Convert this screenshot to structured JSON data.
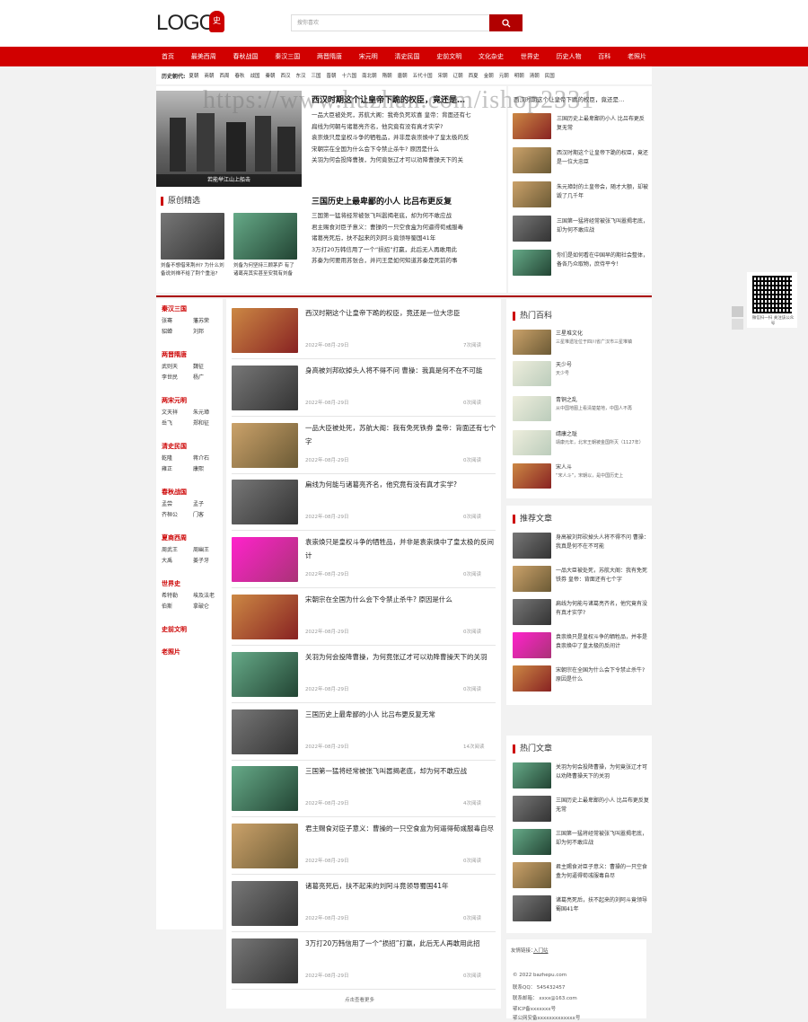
{
  "header": {
    "logo_text": "LOGO",
    "search_placeholder": "搜你喜欢"
  },
  "nav": [
    "首页",
    "最美西周",
    "春秋战国",
    "秦汉三国",
    "两晋隋唐",
    "宋元明",
    "清史民国",
    "史前文明",
    "文化杂史",
    "世界史",
    "历史人物",
    "百科",
    "老照片"
  ],
  "dynasty": {
    "label": "历史朝代:",
    "items": [
      "夏朝",
      "商朝",
      "西周",
      "春秋",
      "战国",
      "秦朝",
      "西汉",
      "东汉",
      "三国",
      "晋朝",
      "十六国",
      "南北朝",
      "隋朝",
      "唐朝",
      "五代十国",
      "宋朝",
      "辽朝",
      "西夏",
      "金朝",
      "元朝",
      "明朝",
      "清朝",
      "民国"
    ]
  },
  "watermark": "https://www.huzhan.com/ishop2331",
  "hero": {
    "caption": "若能举江山上船击"
  },
  "original": {
    "title": "原创精选",
    "items": [
      {
        "text": "刘备不想借来荆州? 为什么刘备说刘禅不给了荆个重治?"
      },
      {
        "text": "刘备为何坚持三顾茅庐 有了诸葛亮其实甚至安我有刘备"
      }
    ]
  },
  "featured": [
    {
      "title": "西汉时期这个让皇帝下跪的权臣，竟还是…",
      "lines": [
        "一品大臣被处死，苏航大阁：我奇负死欢喜 皇帝：背面还有七",
        "扁线为何朝与诸葛亮齐名，他究竟有没有真才实学?",
        "袁崇焕只是皇权斗争的牺牲品，并非是袁崇焕中了皇太极的反",
        "宋朝宗在全国为什么会下令禁止杀牛? 原因是什么",
        "关羽为何会投降曹操，为何竟张辽才可以劝降曹操天下的关"
      ]
    },
    {
      "title": "三国历史上最卑鄙的小人 比吕布更反复",
      "lines": [
        "三国第一猛将经常被张飞叫嚣揭老底，却为何不敢应战",
        "君主赐食对臣子意义：曹操的一只空食盒为何逼得荀彧服毒",
        "诸葛亮死后，扶不起来的刘阿斗竟领导蜀国41年",
        "3万打20万韩信用了一个“损招”打赢，此后无人再敢用此",
        "苏秦为何要用苏张合，并问王是如何知道苏秦是死前的事"
      ]
    }
  ],
  "right_top": [
    {
      "text": "西汉时期这个让皇帝下跪的权臣，竟还是…"
    },
    {
      "text": "三国历史上最卑鄙的小人 比吕布更反复无常"
    },
    {
      "text": "西汉时期这个让皇帝下跪的权臣，竟还是一位大忠臣"
    },
    {
      "text": "朱元璋封的土皇帝会，随才大额，却被毁了几千年"
    },
    {
      "text": "三国第一猛将经常被张飞叫嚣揭老底，却为何不敢应战"
    },
    {
      "text": "你们是如何看在中国早的期社会整体，备各乃众取物，庶侍平今！"
    }
  ],
  "sidebar": [
    {
      "cat": "秦汉三国",
      "subs": [
        "张骞",
        "藩苏荣",
        "貂蝉",
        "刘邦"
      ]
    },
    {
      "cat": "两晋隋唐",
      "subs": [
        "武则天",
        "魏征",
        "李世民",
        "杨广"
      ]
    },
    {
      "cat": "两宋元明",
      "subs": [
        "文天祥",
        "朱元璋",
        "岳飞",
        "郑和征"
      ]
    },
    {
      "cat": "清史民国",
      "subs": [
        "乾隆",
        "蒋介石",
        "雍正",
        "康熙"
      ]
    },
    {
      "cat": "春秋战国",
      "subs": [
        "孟尝",
        "孟子",
        "齐桓公",
        "门客"
      ]
    },
    {
      "cat": "夏商西周",
      "subs": [
        "周武王",
        "周幽王",
        "大禹",
        "姜子牙"
      ]
    },
    {
      "cat": "世界史",
      "subs": [
        "希特勒",
        "埃及法老",
        "伯斯",
        "拿破仑"
      ]
    },
    {
      "cat": "史前文明",
      "subs": []
    },
    {
      "cat": "老照片",
      "subs": []
    }
  ],
  "list": [
    {
      "title": "西汉时期这个让皇帝下跪的权臣，竟还是一位大忠臣",
      "date": "2022年-08月-29日",
      "views": "7次阅读"
    },
    {
      "title": "身高被刘邦砍掉头人将不得不问 曹操：我真是何不在不可能",
      "date": "2022年-08月-29日",
      "views": "0次阅读"
    },
    {
      "title": "一品大臣被处死，苏航大阁：我有免死铁券 皇帝：背面还有七个字",
      "date": "2022年-08月-29日",
      "views": "0次阅读"
    },
    {
      "title": "扁线为何能与诸葛亮齐名，他究竟有没有真才实学?",
      "date": "2022年-08月-29日",
      "views": "0次阅读"
    },
    {
      "title": "袁崇焕只是皇权斗争的牺牲品，并非是袁崇焕中了皇太极的反间计",
      "date": "2022年-08月-29日",
      "views": "0次阅读"
    },
    {
      "title": "宋朝宗在全国为什么会下令禁止杀牛? 原因是什么",
      "date": "2022年-08月-29日",
      "views": "0次阅读"
    },
    {
      "title": "关羽为何会投降曹操，为何竟张辽才可以劝降曹操天下的关羽",
      "date": "2022年-08月-29日",
      "views": "0次阅读"
    },
    {
      "title": "三国历史上最卑鄙的小人 比吕布更反复无常",
      "date": "2022年-08月-29日",
      "views": "14次阅读"
    },
    {
      "title": "三国第一猛将经常被张飞叫嚣揭老底，却为何不敢应战",
      "date": "2022年-08月-29日",
      "views": "4次阅读"
    },
    {
      "title": "君主赐食对臣子意义：曹操的一只空食盒为何逼得荀彧服毒自尽",
      "date": "2022年-08月-29日",
      "views": "0次阅读"
    },
    {
      "title": "诸葛亮死后，扶不起来的刘阿斗竟领导蜀国41年",
      "date": "2022年-08月-29日",
      "views": "0次阅读"
    },
    {
      "title": "3万打20万韩信用了一个“损招”打赢，此后无人再敢用此招",
      "date": "2022年-08月-29日",
      "views": "0次阅读"
    }
  ],
  "more": "点击查看更多",
  "hot_baike": {
    "title": "热门百科",
    "items": [
      {
        "name": "三星堆文化",
        "desc": "三星堆遗址位于四川省广汉市三星堆镇"
      },
      {
        "name": "天少号",
        "desc": "天少号"
      },
      {
        "name": "青铜之乱",
        "desc": "从中国地图上看清楚楚地，中国人不再"
      },
      {
        "name": "靖康之耻",
        "desc": "靖康元年，北宋王朝被金国所灭（1127年）"
      },
      {
        "name": "宋人斗",
        "desc": "“宋人斗”，宋朝以，是中国历史上"
      }
    ]
  },
  "recommend": {
    "title": "推荐文章",
    "items": [
      {
        "text": "身高被刘邦砍掉头人将不得不问 曹操：我真是何不在不可能"
      },
      {
        "text": "一品大臣被处死，苏航大阁：我有免死铁券 皇帝：背面还有七个字"
      },
      {
        "text": "扁线为何能与诸葛亮齐名，他究竟有没有真才实学?"
      },
      {
        "text": "袁崇焕只是皇权斗争的牺牲品，并非是袁崇焕中了皇太极的反间计"
      },
      {
        "text": "宋朝宗在全国为什么会下令禁止杀牛? 原因是什么"
      }
    ]
  },
  "hot_articles": {
    "title": "热门文章",
    "items": [
      {
        "text": "关羽为何会投降曹操，为何竟张辽才可以劝降曹操天下的关羽"
      },
      {
        "text": "三国历史上最卑鄙的小人 比吕布更反复无常"
      },
      {
        "text": "三国第一猛将经常被张飞叫嚣揭老底，却为何不敢应战"
      },
      {
        "text": "君主赐食对臣子意义：曹操的一只空食盒为何逼得荀彧服毒自尽"
      },
      {
        "text": "诸葛亮死后，扶不起来的刘阿斗竟领导蜀国41年"
      }
    ]
  },
  "footer": {
    "links_label": "友情链接：",
    "links": "入门站",
    "copyright": "© 2022 bazhepu.com",
    "qq": "联系QQ：  545432457",
    "email": "联系邮箱：  xxxx@163.com",
    "icp": "鄂ICP备xxxxxxx号",
    "police": "鄂公网安备xxxxxxxxxxxxx号"
  },
  "qr": {
    "caption": "微信扫一扫 关注该公众号"
  },
  "colors": {
    "brand": "#d10000",
    "dark_red": "#a00"
  }
}
